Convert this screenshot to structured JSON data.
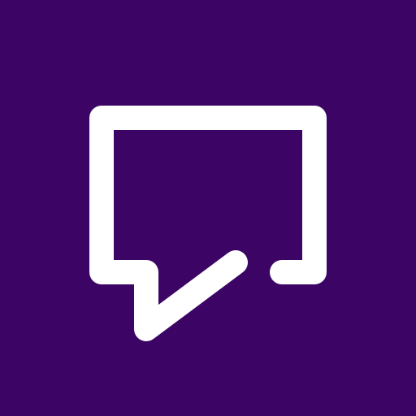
{
  "icon": {
    "name": "chat-bubble-icon",
    "background_color": "#3C0464",
    "foreground_color": "#FFFFFF"
  }
}
